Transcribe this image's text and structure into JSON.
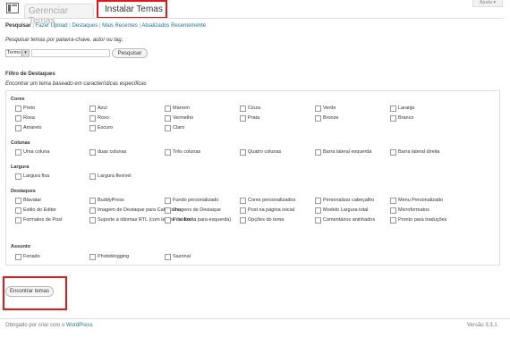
{
  "header": {
    "tab_manage": "Gerenciar Temas",
    "tab_install": "Instalar Temas",
    "help": "Ajuda ▾"
  },
  "subnav": [
    {
      "label": "Pesquisar"
    },
    {
      "label": "Fazer Upload"
    },
    {
      "label": "Destaques"
    },
    {
      "label": "Mais Recentes"
    },
    {
      "label": "Atualizados Recentemente"
    }
  ],
  "search": {
    "description": "Pesquisar temas por palavra-chave, autor ou tag.",
    "type_value": "Termo",
    "input_value": "",
    "button": "Pesquisar"
  },
  "filter": {
    "title": "Filtro de Destaques",
    "description": "Encontrar um tema baseado em características específicas"
  },
  "groups": {
    "cores": {
      "title": "Cores",
      "items": [
        "Preto",
        "Azul",
        "Marrom",
        "Cinza",
        "Verde",
        "Laranja",
        "Rosa",
        "Roxo",
        "Vermelho",
        "Prata",
        "Bronze",
        "Branco",
        "Amarelo",
        "Escuro",
        "Claro"
      ]
    },
    "colunas": {
      "title": "Colunas",
      "items": [
        "Uma coluna",
        "duas colunas",
        "Três colunas",
        "Quatro colunas",
        "Barra lateral esquerda",
        "Barra lateral direita"
      ]
    },
    "largura": {
      "title": "Largura",
      "items": [
        "Largura fixa",
        "Largura flexível"
      ]
    },
    "destaques": {
      "title": "Destaques",
      "items": [
        "Blavatar",
        "BuddyPress",
        "Fundo personalizado",
        "Cores personalizados",
        "Personalizar cabeçalho",
        "Menu Personalizado",
        "Estilo do Editor",
        "Imagem de Destaque para Cabeçalho",
        "Imagens de Destaque",
        "Post na página inicial",
        "Modelo Largura total",
        "Microformatos",
        "Formatos de Post",
        "Suporte à idiomas RTL (com leitura da direita para esquerda)",
        "Post fixo",
        "Opções do tema",
        "Comentários aninhados",
        "Pronto para traduções"
      ]
    },
    "assunto": {
      "title": "Assunto",
      "items": [
        "Feriado",
        "Photoblogging",
        "Sazonal"
      ]
    }
  },
  "find_button": "Encontrar temas",
  "footer": {
    "left_prefix": "Obrigado por criar com o ",
    "left_link": "WordPress",
    "right": "Versão 3.3.1"
  }
}
